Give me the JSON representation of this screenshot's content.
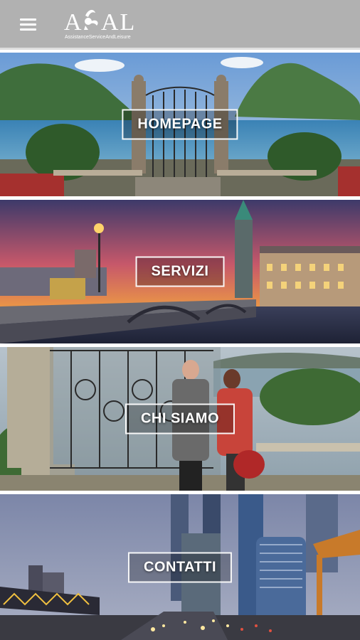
{
  "header": {
    "logo_text": "ASAL",
    "logo_tagline": "AssistanceServiceAndLeisure"
  },
  "tiles": [
    {
      "label": "HOMEPAGE"
    },
    {
      "label": "SERVIZI"
    },
    {
      "label": "CHI SIAMO"
    },
    {
      "label": "CONTATTI"
    }
  ],
  "colors": {
    "topbar": "#b1b1b1",
    "label_border": "#ffffff"
  },
  "icons": {
    "menu": "hamburger-menu-icon"
  }
}
